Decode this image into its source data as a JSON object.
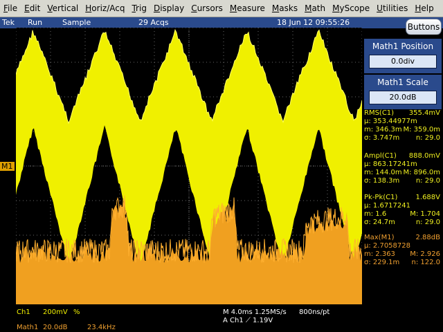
{
  "menu": [
    "File",
    "Edit",
    "Vertical",
    "Horiz/Acq",
    "Trig",
    "Display",
    "Cursors",
    "Measure",
    "Masks",
    "Math",
    "MyScope",
    "Utilities",
    "Help"
  ],
  "status": {
    "brand": "Tek",
    "run": "Run",
    "mode": "Sample",
    "acqs": "29 Acqs",
    "datetime": "18 Jun 12 09:55:26"
  },
  "buttons_label": "Buttons",
  "marker": "M1",
  "math_position": {
    "title": "Math1 Position",
    "value": "0.0div"
  },
  "math_scale": {
    "title": "Math1 Scale",
    "value": "20.0dB"
  },
  "measurements": [
    {
      "color": "#f0f020",
      "title": "RMS(C1)",
      "current": "355.4mV",
      "mean": "µ: 353.44977m",
      "min": "m: 346.3m",
      "max": "M: 359.0m",
      "sigma": "σ: 3.747m",
      "n": "n: 29.0"
    },
    {
      "color": "#f0f020",
      "title": "Ampl(C1)",
      "current": "888.0mV",
      "mean": "µ: 863.17241m",
      "min": "m: 144.0m",
      "max": "M: 896.0m",
      "sigma": "σ: 138.3m",
      "n": "n: 29.0"
    },
    {
      "color": "#f0f020",
      "title": "Pk-Pk(C1)",
      "current": "1.688V",
      "mean": "µ: 1.6717241",
      "min": "m: 1.6",
      "max": "M: 1.704",
      "sigma": "σ: 24.7m",
      "n": "n: 29.0"
    },
    {
      "color": "#f0a030",
      "title": "Max(M1)",
      "current": "2.88dB",
      "mean": "µ: 2.7058728",
      "min": "m: 2.363",
      "max": "M: 2.926",
      "sigma": "σ: 229.1m",
      "n": "n: 122.0"
    }
  ],
  "bottom": {
    "ch1": "Ch1",
    "ch1_scale": "200mV",
    "ch1_coupling": "%",
    "timebase": "M 4.0ms 1.25MS/s",
    "sample_interval": "800ns/pt",
    "trigger": "A  Ch1  ⟋  1.19V",
    "math1": "Math1",
    "math1_scale": "20.0dB",
    "math1_freq": "23.4kHz"
  },
  "colors": {
    "ch1": "#f0f000",
    "math1": "#f0a020",
    "grid": "#6a6a6a",
    "panel": "#2a4a8c"
  }
}
